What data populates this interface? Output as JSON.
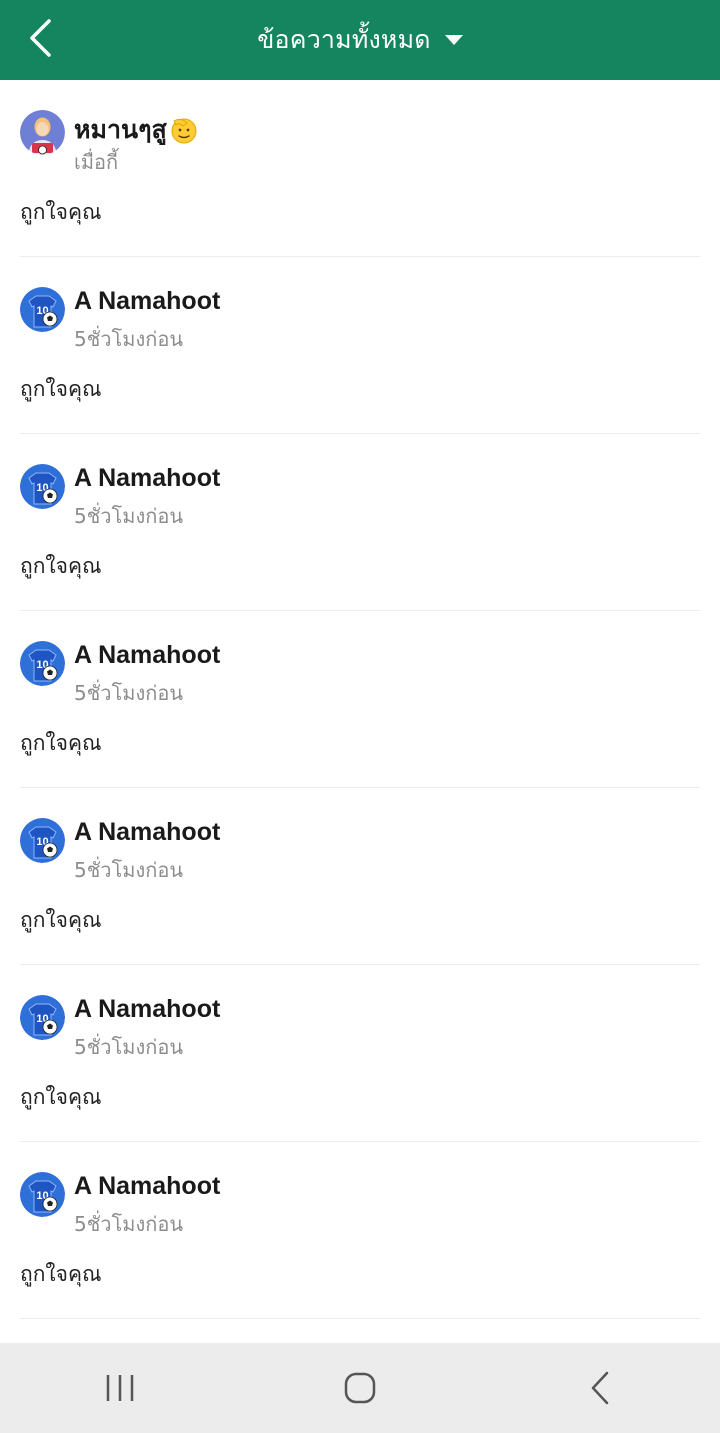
{
  "header": {
    "title": "ข้อความทั้งหมด",
    "back_icon": "chevron-left-icon",
    "dropdown_icon": "caret-down-icon",
    "color": "#14855f"
  },
  "notifications": [
    {
      "name": "หมานๆสู",
      "time": "เมื่อกี้",
      "message": "ถูกใจคุณ",
      "avatar": "blonde-person-avatar",
      "name_emoji": "saluting-face-emoji"
    },
    {
      "name": "A Namahoot",
      "time": "5ชั่วโมงก่อน",
      "message": "ถูกใจคุณ",
      "avatar": "jersey-10-soccer-avatar"
    },
    {
      "name": "A Namahoot",
      "time": "5ชั่วโมงก่อน",
      "message": "ถูกใจคุณ",
      "avatar": "jersey-10-soccer-avatar"
    },
    {
      "name": "A Namahoot",
      "time": "5ชั่วโมงก่อน",
      "message": "ถูกใจคุณ",
      "avatar": "jersey-10-soccer-avatar"
    },
    {
      "name": "A Namahoot",
      "time": "5ชั่วโมงก่อน",
      "message": "ถูกใจคุณ",
      "avatar": "jersey-10-soccer-avatar"
    },
    {
      "name": "A Namahoot",
      "time": "5ชั่วโมงก่อน",
      "message": "ถูกใจคุณ",
      "avatar": "jersey-10-soccer-avatar"
    },
    {
      "name": "A Namahoot",
      "time": "5ชั่วโมงก่อน",
      "message": "ถูกใจคุณ",
      "avatar": "jersey-10-soccer-avatar"
    }
  ],
  "system_nav": {
    "recents_icon": "recent-apps-icon",
    "home_icon": "home-icon",
    "back_icon": "system-back-icon"
  }
}
